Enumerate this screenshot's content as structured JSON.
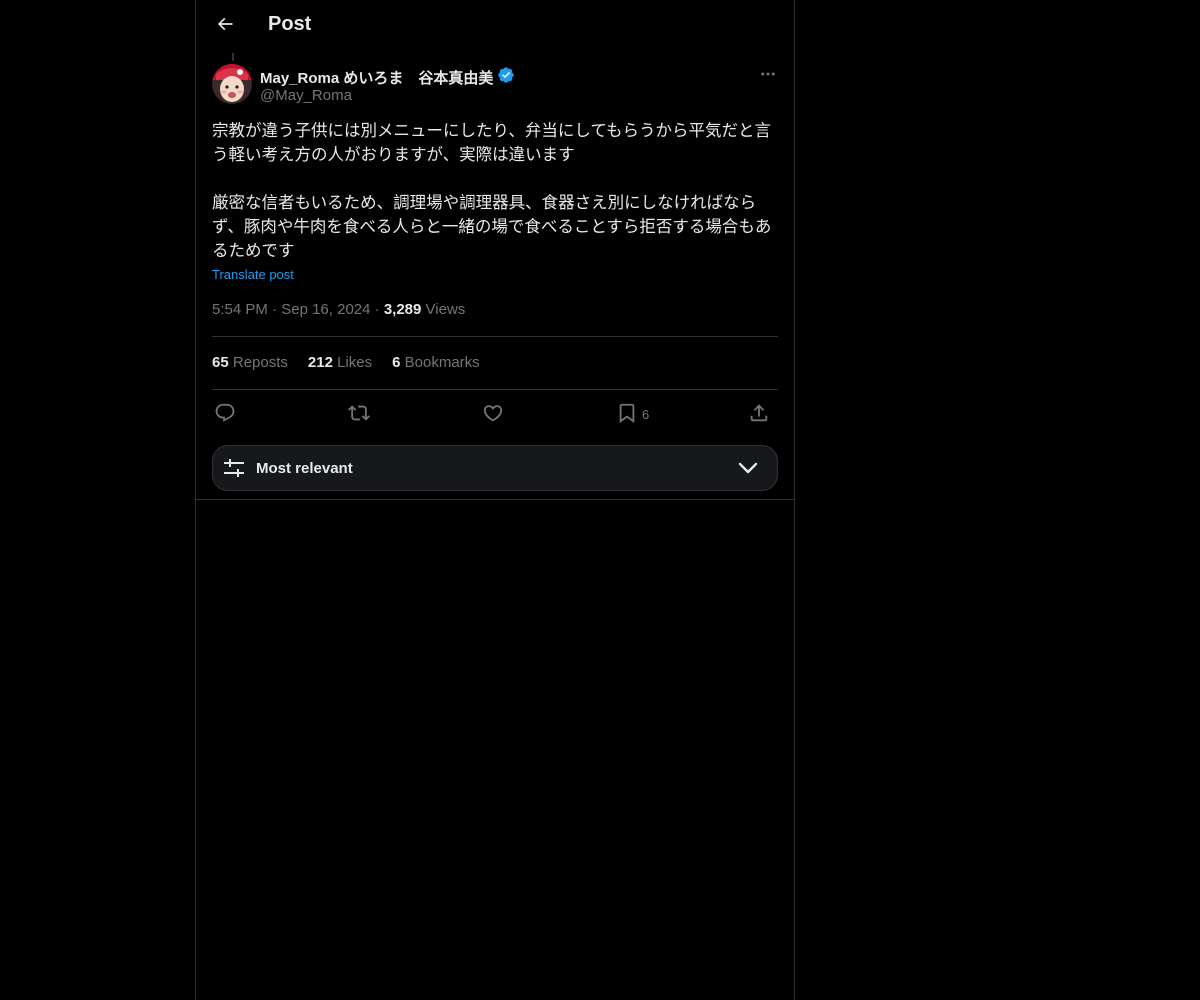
{
  "header": {
    "title": "Post"
  },
  "author": {
    "display_name": "May_Roma めいろま　谷本真由美",
    "handle": "@May_Roma",
    "verified": true
  },
  "post": {
    "paragraph1": "宗教が違う子供には別メニューにしたり、弁当にしてもらうから平気だと言う軽い考え方の人がおりますが、実際は違います",
    "paragraph2": "厳密な信者もいるため、調理場や調理器具、食器さえ別にしなければならず、豚肉や牛肉を食べる人らと一緒の場で食べることすら拒否する場合もあるためです",
    "translate_label": "Translate post",
    "time": "5:54 PM",
    "date": "Sep 16, 2024",
    "views_count": "3,289",
    "views_label": "Views",
    "separator": "·"
  },
  "stats": {
    "reposts_count": "65",
    "reposts_label": "Reposts",
    "likes_count": "212",
    "likes_label": "Likes",
    "bookmarks_count": "6",
    "bookmarks_label": "Bookmarks"
  },
  "actions": {
    "bookmark_count": "6"
  },
  "sort": {
    "label": "Most relevant"
  },
  "icons": {
    "back": "arrow-left-icon",
    "more": "more-horizontal-icon",
    "verified": "verified-badge-icon",
    "reply": "reply-icon",
    "repost": "repost-icon",
    "like": "heart-icon",
    "bookmark": "bookmark-icon",
    "share": "share-icon",
    "sort": "sliders-icon",
    "chevron": "chevron-down-icon"
  },
  "colors": {
    "background": "#000000",
    "text": "#e7e9ea",
    "muted": "#71767b",
    "accent": "#1d9bf0",
    "border": "#2f3336"
  }
}
